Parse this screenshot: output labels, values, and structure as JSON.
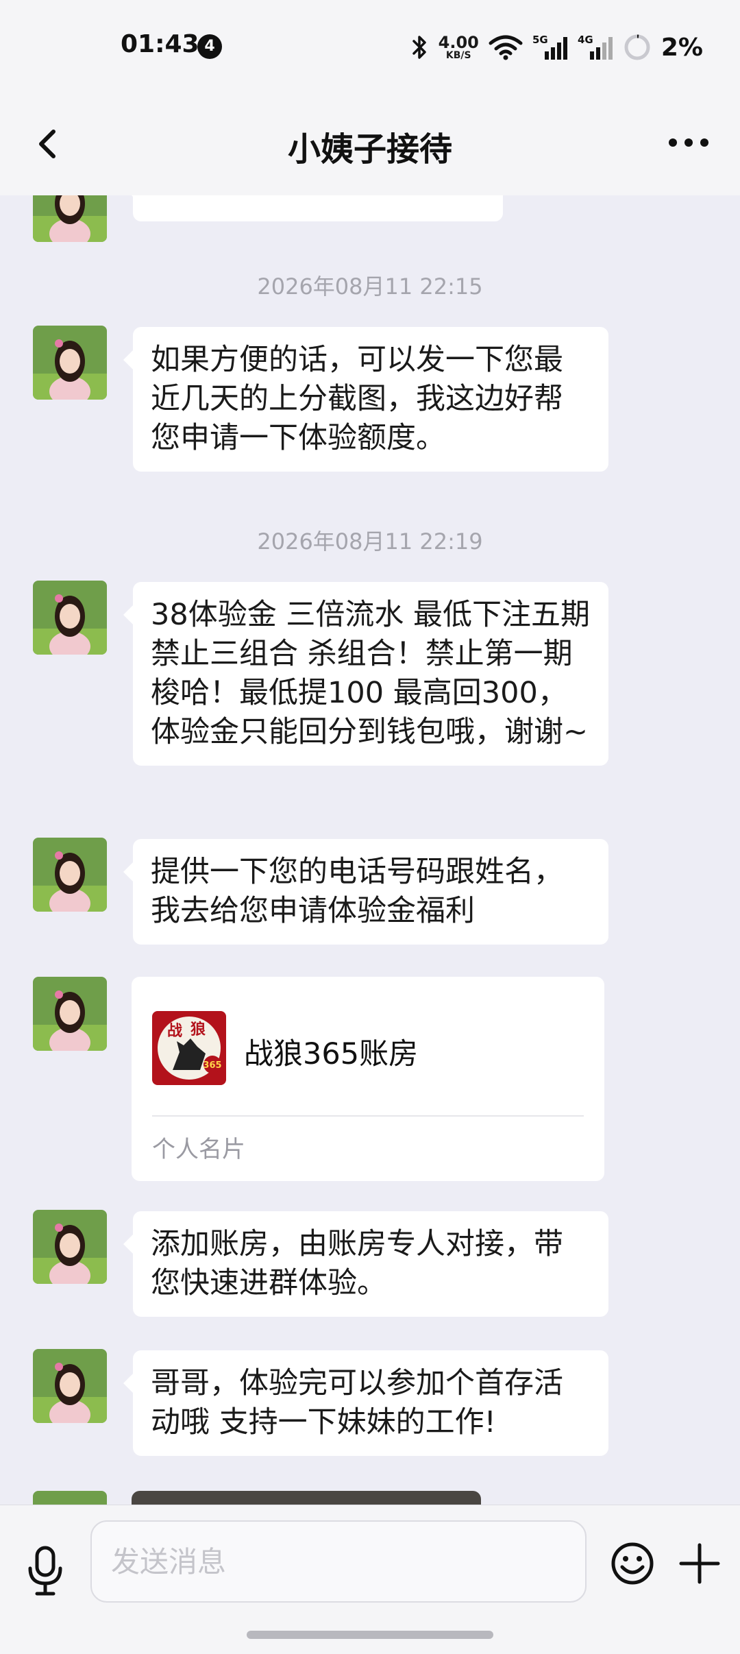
{
  "status_bar": {
    "time": "01:43",
    "notification_count": "4",
    "net_speed_value": "4.00",
    "net_speed_unit": "KB/S",
    "signal_5g": "5G",
    "signal_4g": "4G",
    "battery": "2%"
  },
  "header": {
    "title": "小姨子接待"
  },
  "chat": {
    "timestamps": [
      "2026年08月11 22:15",
      "2026年08月11 22:19"
    ],
    "messages": [
      "如果方便的话，可以发一下您最近几天的上分截图，我这边好帮您申请一下体验额度。",
      "38体验金 三倍流水 最低下注五期 禁止三组合 杀组合！禁止第一期梭哈！最低提100 最高回300，体验金只能回分到钱包哦，谢谢~",
      "提供一下您的电话号码跟姓名，我去给您申请体验金福利",
      "添加账房，由账房专人对接，带您快速进群体验。",
      "哥哥，体验完可以参加个首存活动哦 支持一下妹妹的工作!"
    ],
    "card": {
      "name": "战狼365账房",
      "label": "个人名片",
      "logo_text_1": "战",
      "logo_text_2": "狼",
      "logo_number": "365"
    }
  },
  "input_bar": {
    "placeholder": "发送消息"
  },
  "colors": {
    "chat_background": "#ededf5",
    "bubble": "#ffffff",
    "bar": "#f5f5f7",
    "logo_red": "#b3121b"
  }
}
